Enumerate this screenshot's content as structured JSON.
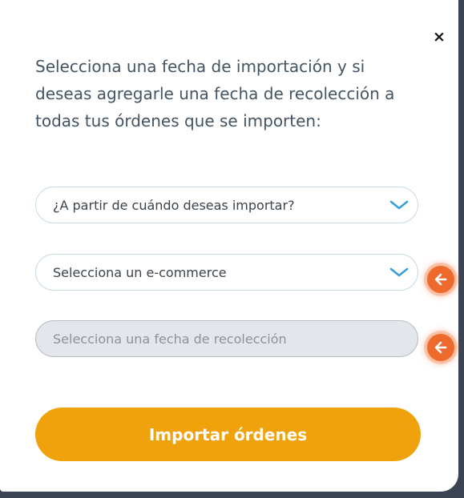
{
  "modal": {
    "close_label": "×",
    "title": "Selecciona una fecha de importación y si deseas agregarle una fecha de recolección a todas tus órdenes que se importen:"
  },
  "form": {
    "import_date_select": {
      "label": "¿A partir de cuándo deseas importar?",
      "icon": "chevron-down-icon"
    },
    "ecommerce_select": {
      "label": "Selecciona un e-commerce",
      "icon": "chevron-down-icon"
    },
    "pickup_date_field": {
      "placeholder": "Selecciona una fecha de recolección"
    },
    "hint_icons": [
      "arrow-left-icon",
      "arrow-left-icon"
    ],
    "submit_label": "Importar órdenes"
  },
  "colors": {
    "accent": "#f0a20c",
    "hint": "#ee6a2c",
    "chevron": "#3aa0d8",
    "text": "#445463"
  }
}
